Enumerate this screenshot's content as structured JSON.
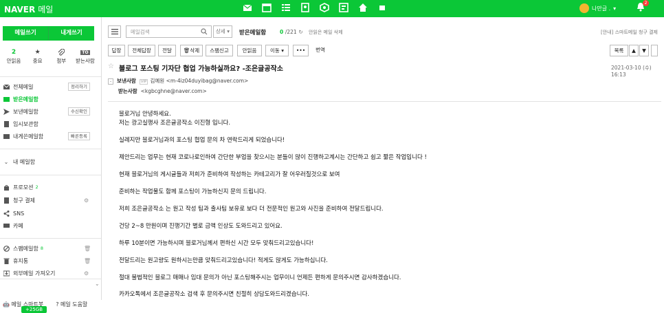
{
  "brand": {
    "naver": "NAVER",
    "mail": "메일"
  },
  "top_icons": [
    "mail-icon",
    "calendar-icon",
    "list-icon",
    "contacts-icon",
    "cube-icon",
    "memo-icon",
    "home-icon",
    "box-icon"
  ],
  "user": {
    "name": "나만글 .",
    "notification_count": "2"
  },
  "sidebar": {
    "write_button": "메일쓰기",
    "write_self_button": "내게쓰기",
    "quick": [
      {
        "icon": "count",
        "value": "2",
        "label": "안읽음"
      },
      {
        "icon": "star-icon",
        "value": "★",
        "label": "중요"
      },
      {
        "icon": "clip-icon",
        "value": "⌀",
        "label": "첨부"
      },
      {
        "icon": "to-icon",
        "value": "TO",
        "label": "받는사람"
      }
    ],
    "folders": [
      {
        "label": "전체메일",
        "tag": "정리하기"
      },
      {
        "label": "받은메일함",
        "tag": ""
      },
      {
        "label": "보낸메일함",
        "tag": "수신확인"
      },
      {
        "label": "임시보관함",
        "tag": ""
      },
      {
        "label": "내게쓴메일함",
        "tag": "빠른등록"
      }
    ],
    "my_mailbox": "내 메일함",
    "extras": [
      {
        "label": "프로모션",
        "count": "2"
      },
      {
        "label": "청구 결제",
        "count": ""
      },
      {
        "label": "SNS",
        "count": ""
      },
      {
        "label": "카페",
        "count": ""
      }
    ],
    "bottom_folders": [
      {
        "label": "스팸메일함",
        "count": "8"
      },
      {
        "label": "휴지통",
        "count": ""
      },
      {
        "label": "외부메일 가져오기",
        "count": ""
      }
    ],
    "bottom_links": [
      "메일 스마트봇",
      "메일 도움말"
    ],
    "storage": "+25GB"
  },
  "toolbar": {
    "search_placeholder": "메일검색",
    "detail": "상세 ▾",
    "box_title": "받은메일함",
    "unread": "0",
    "total": "/221",
    "unread_delete": "안읽은 메일 삭제",
    "promo": "[안내] 스마트메일 청구 결제",
    "buttons": [
      "답장",
      "전체답장",
      "전달",
      "삭제",
      "스팸신고",
      "안읽음",
      "이동 ▾",
      "•••",
      "번역"
    ],
    "list_button": "목록"
  },
  "mail": {
    "subject": "블로그 포스팅 기자단 협업 가능하실까요? -조은글공작소",
    "date": "2021-03-10 (수) 16:13",
    "from_label": "보낸사람",
    "vip": "VIP",
    "from": "김예원 <m-4iz04duyibag@naver.com>",
    "to_label": "받는사람",
    "to": "<kgbcghne@naver.com>",
    "lines": [
      "블로거님 안녕하세요.",
      "저는 광고실행사 조은글공작소 이진형 입니다.",
      "실례지만 블로거님과의 포스팅 협업 문의 차 연락드리게 되었습니다!",
      "제안드리는 업무는 현재 코로나로인하여 간단한 부업을 찾으시는 분들이 많이 진행하고계시는 간단하고 쉽고 짧은 작업입니다 !",
      "현재 블로거님의 게시글들과 저희가 준비하여 작성하는 카테고리가 잘 어우러질것으로 보여",
      "준비하는 작업물도 함께 포스팅이 가능하신지 문의 드립니다.",
      "저희 조은글공작소 는 원고 작성 팀과 출사팀 보유로 보다 더 전문적인 원고와 사진을 준비하여 전달드립니다.",
      "건당 2~8 만원이며 진행기간 별로 금액 인상도 도와드리고 있어요.",
      "하루 10분이면 가능하시며 블로거님께서 편하신 시간 모두 맞춰드리고있습니다!",
      "전달드리는 원고량도 원하시는만큼 맞춰드리고있습니다! 적게도 많게도 가능하십니다.",
      "절대 불법적인 블로그 매매나 임대 문의가 아닌 포스팅해주시는 업무이니 언제든 편하게 문의주시면 감사하겠습니다.",
      "카카오톡에서 조은글공작소 검색 후 문의주시면 친절히 상담도와드리겠습니다."
    ]
  }
}
